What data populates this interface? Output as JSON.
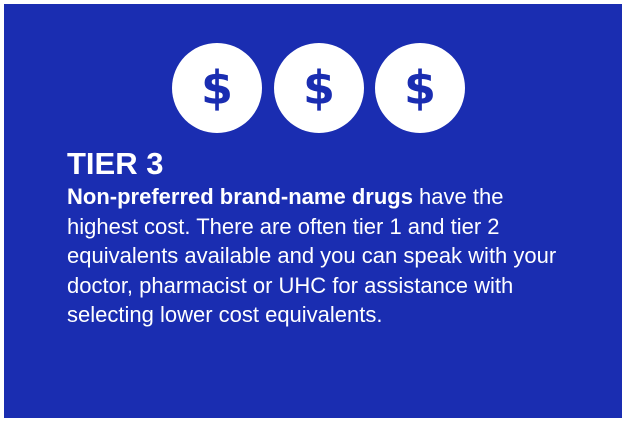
{
  "card": {
    "background_color": "#1a2db1",
    "text_color": "#ffffff",
    "icons": [
      {
        "name": "dollar-sign-icon",
        "glyph": "$"
      },
      {
        "name": "dollar-sign-icon",
        "glyph": "$"
      },
      {
        "name": "dollar-sign-icon",
        "glyph": "$"
      }
    ],
    "title": "TIER 3",
    "description_bold": "Non-preferred brand-name drugs",
    "description_rest": " have the highest cost. There are often tier 1 and tier 2 equivalents available and you can speak with your doctor, pharmacist or UHC for assistance with selecting lower cost equivalents."
  }
}
